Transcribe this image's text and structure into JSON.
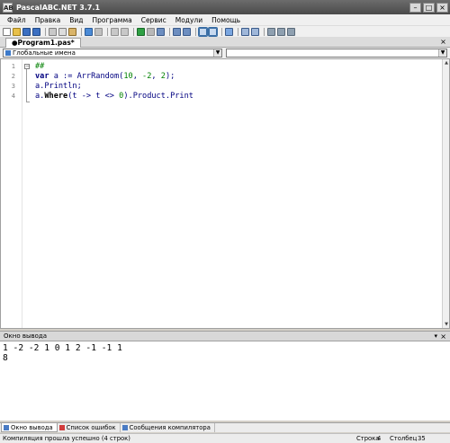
{
  "window": {
    "title": "PascalABC.NET 3.7.1",
    "icon_text": "AB"
  },
  "menu": [
    "Файл",
    "Правка",
    "Вид",
    "Программа",
    "Сервис",
    "Модули",
    "Помощь"
  ],
  "tab": {
    "label": "●Program1.pas*"
  },
  "combos": {
    "left_value": "Глобальные имена",
    "right_value": ""
  },
  "editor": {
    "line_numbers": [
      "1",
      "2",
      "3",
      "4"
    ],
    "lines": [
      [
        {
          "t": "##",
          "c": "dir"
        }
      ],
      [
        {
          "t": "var",
          "c": "kw"
        },
        {
          "t": " a := ArrRandom(",
          "c": "plain"
        },
        {
          "t": "10",
          "c": "num"
        },
        {
          "t": ", ",
          "c": "plain"
        },
        {
          "t": "-2",
          "c": "num"
        },
        {
          "t": ", ",
          "c": "plain"
        },
        {
          "t": "2",
          "c": "num"
        },
        {
          "t": ");",
          "c": "plain"
        }
      ],
      [
        {
          "t": "a.Println;",
          "c": "plain"
        }
      ],
      [
        {
          "t": "a.",
          "c": "plain"
        },
        {
          "t": "Where",
          "c": "kwb"
        },
        {
          "t": "(t -> t <> ",
          "c": "plain"
        },
        {
          "t": "0",
          "c": "num"
        },
        {
          "t": ").Product.Print",
          "c": "plain"
        }
      ]
    ]
  },
  "output": {
    "header": "Окно вывода",
    "lines": [
      "1 -2 -2 1 0 1 2 -1 -1 1",
      "8"
    ]
  },
  "bottom_tabs": [
    {
      "label": "Окно вывода",
      "active": true,
      "icon_color": "#4a7bc4"
    },
    {
      "label": "Список ошибок",
      "active": false,
      "icon_color": "#d23c3c"
    },
    {
      "label": "Сообщения компилятора",
      "active": false,
      "icon_color": "#4a7bc4"
    }
  ],
  "status": {
    "message": "Компиляция прошла успешно (4 строк)",
    "row_label": "Строка",
    "row_value": "4",
    "col_label": "Столбец",
    "col_value": "35"
  },
  "toolbar_icons": [
    {
      "name": "new-file-icon",
      "color": "#ffffff",
      "border": "#7a7a7a"
    },
    {
      "name": "open-folder-icon",
      "color": "#e8c04a",
      "border": "#a08020"
    },
    {
      "name": "save-icon",
      "color": "#3b6fc2",
      "border": "#234a85"
    },
    {
      "name": "save-all-icon",
      "color": "#3b6fc2",
      "border": "#234a85"
    },
    {
      "name": "sep"
    },
    {
      "name": "cut-icon",
      "color": "#c8c8c8",
      "border": "#808080"
    },
    {
      "name": "copy-icon",
      "color": "#dcdcdc",
      "border": "#808080"
    },
    {
      "name": "paste-icon",
      "color": "#d9b46a",
      "border": "#8a6a2a"
    },
    {
      "name": "sep"
    },
    {
      "name": "undo-icon",
      "color": "#4a8ad6",
      "border": "#2a5a96"
    },
    {
      "name": "redo-icon",
      "color": "#c0c0c0",
      "border": "#909090"
    },
    {
      "name": "sep"
    },
    {
      "name": "find-icon",
      "color": "#c8c8c8",
      "border": "#909090"
    },
    {
      "name": "replace-icon",
      "color": "#c8c8c8",
      "border": "#909090"
    },
    {
      "name": "sep"
    },
    {
      "name": "run-icon",
      "color": "#2ea043",
      "border": "#1a6a2a"
    },
    {
      "name": "stop-icon",
      "color": "#b8b8b8",
      "border": "#8a8a8a"
    },
    {
      "name": "compile-icon",
      "color": "#6d8ec0",
      "border": "#3a5a8a"
    },
    {
      "name": "sep"
    },
    {
      "name": "step-over-icon",
      "color": "#6d8ec0",
      "border": "#3a5a8a"
    },
    {
      "name": "step-into-icon",
      "color": "#6d8ec0",
      "border": "#3a5a8a"
    },
    {
      "name": "sep"
    },
    {
      "name": "split-view-icon",
      "color": "#ffffff",
      "border": "#3a6ea5",
      "active": true
    },
    {
      "name": "output-panel-icon",
      "color": "#ffffff",
      "border": "#3a6ea5",
      "active": true
    },
    {
      "name": "sep"
    },
    {
      "name": "format-icon",
      "color": "#7aa6e0",
      "border": "#3a5a8a"
    },
    {
      "name": "sep"
    },
    {
      "name": "form-designer-icon",
      "color": "#9fb7d9",
      "border": "#3a5a8a"
    },
    {
      "name": "code-template-icon",
      "color": "#9fb7d9",
      "border": "#3a5a8a"
    },
    {
      "name": "sep"
    },
    {
      "name": "options-icon",
      "color": "#8fa0b0",
      "border": "#5a6a7a"
    },
    {
      "name": "window-icon",
      "color": "#8fa0b0",
      "border": "#5a6a7a"
    },
    {
      "name": "help-icon",
      "color": "#8fa0b0",
      "border": "#5a6a7a"
    }
  ]
}
